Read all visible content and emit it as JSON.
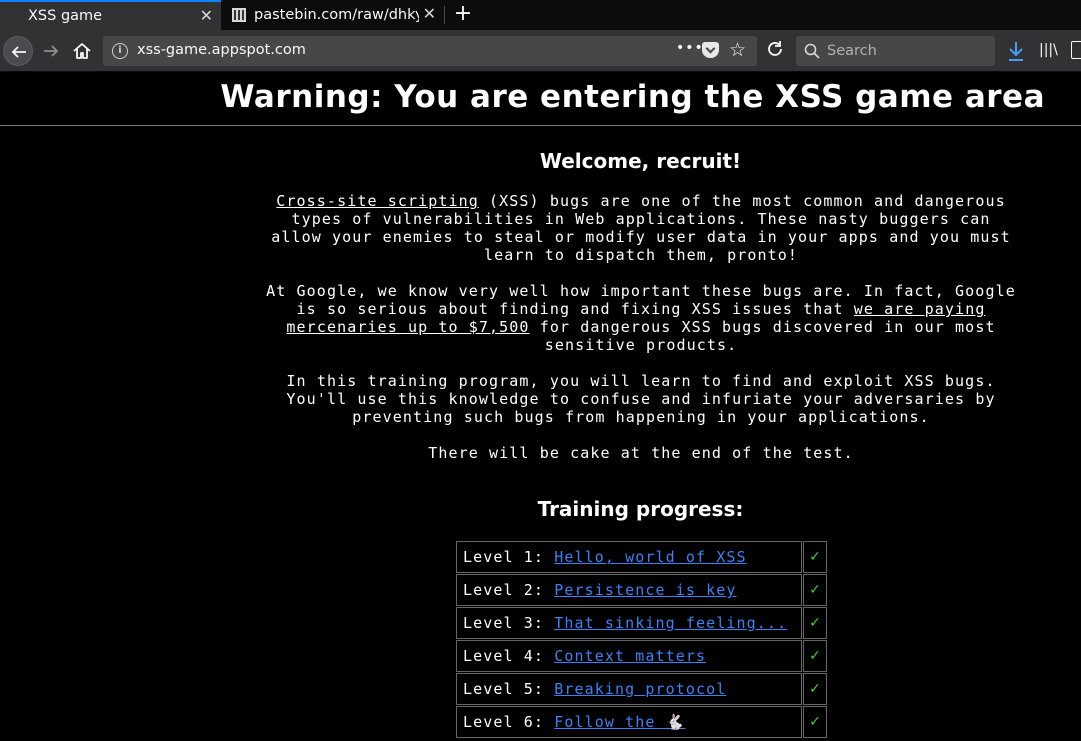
{
  "browser": {
    "tabs": [
      {
        "title": "XSS game",
        "active": true
      },
      {
        "title": "pastebin.com/raw/dhky",
        "active": false
      }
    ],
    "new_tab_label": "+",
    "close_glyph": "✕",
    "url": "xss-game.appspot.com",
    "more_glyph": "•••",
    "star_glyph": "☆",
    "search_placeholder": "Search",
    "library_glyph": "|||\\",
    "accent_color": "#0a84ff"
  },
  "page": {
    "warning_title": "Warning: You are entering the XSS game area",
    "welcome": "Welcome, recruit!",
    "p1_link": "Cross-site scripting",
    "p1_text": " (XSS) bugs are one of the most common and dangerous types of vulnerabilities in Web applications. These nasty buggers can allow your enemies to steal or modify user data in your apps and you must learn to dispatch them, pronto!",
    "p2_before": "At Google, we know very well how important these bugs are. In fact, Google is so serious about finding and fixing XSS issues that ",
    "p2_link": "we are paying mercenaries up to $7,500",
    "p2_after": " for dangerous XSS bugs discovered in our most sensitive products.",
    "p3": "In this training program, you will learn to find and exploit XSS bugs. You'll use this knowledge to confuse and infuriate your adversaries by preventing such bugs from happening in your applications.",
    "p4": "There will be cake at the end of the test.",
    "training_title": "Training progress:",
    "check_glyph": "✓",
    "check_color": "#3fce3f",
    "link_color": "#3b82f6",
    "levels": [
      {
        "label": "Level 1: ",
        "link": "Hello, world of XSS"
      },
      {
        "label": "Level 2: ",
        "link": "Persistence is key"
      },
      {
        "label": "Level 3: ",
        "link": "That sinking feeling..."
      },
      {
        "label": "Level 4: ",
        "link": "Context matters"
      },
      {
        "label": "Level 5: ",
        "link": "Breaking protocol"
      },
      {
        "label": "Level 6: ",
        "link": "Follow the 🐇"
      }
    ]
  }
}
